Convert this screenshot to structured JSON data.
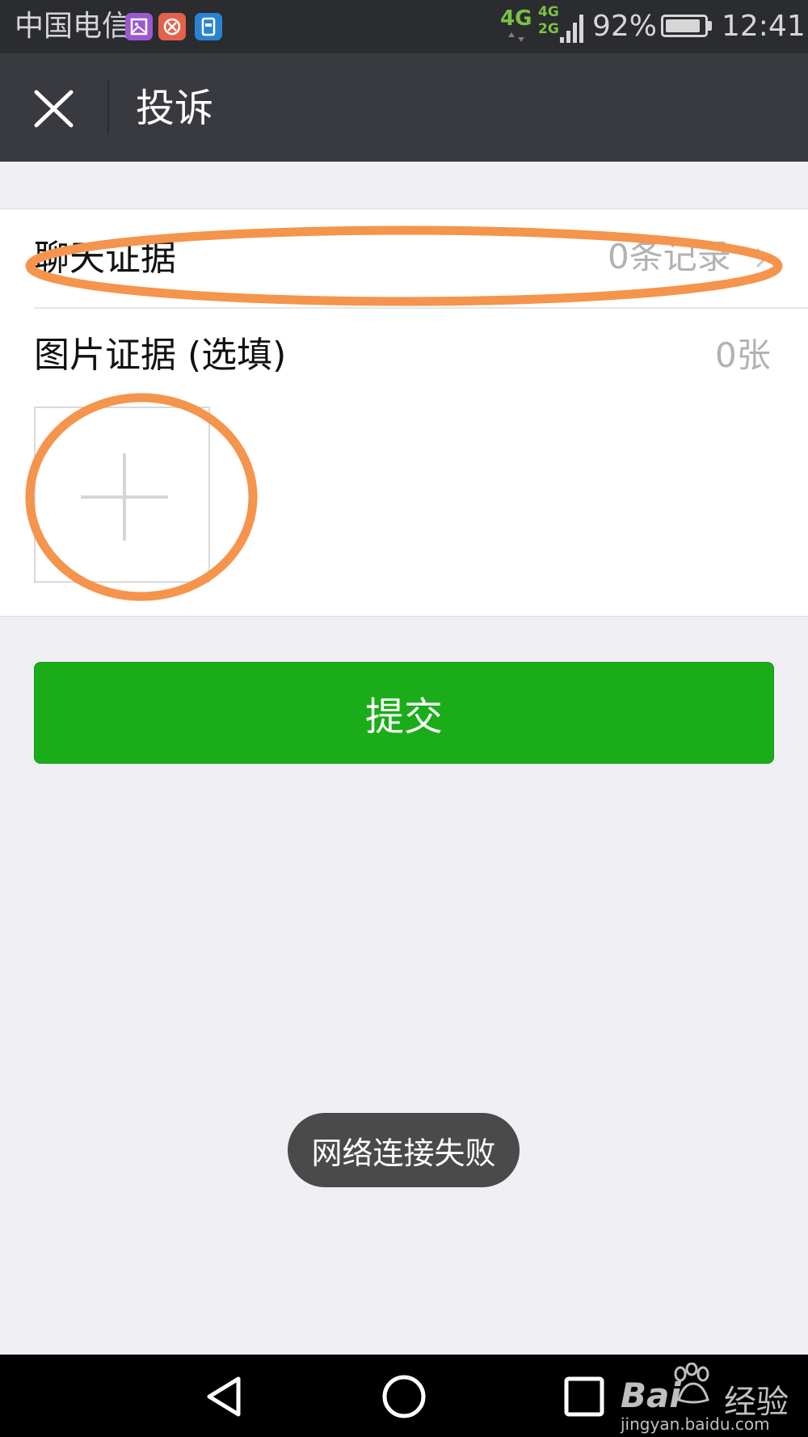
{
  "status_bar": {
    "carrier": "中国电信",
    "network_primary": "4G",
    "network_secondary": [
      "4G",
      "2G"
    ],
    "battery_percent": "92%",
    "battery_level": 0.92,
    "time": "12:41",
    "notification_icons": [
      "gallery-icon",
      "tools-icon",
      "sim-icon"
    ]
  },
  "header": {
    "title": "投诉",
    "close_icon": "close-icon"
  },
  "form": {
    "chat_evidence": {
      "label": "聊天证据",
      "value": "0条记录"
    },
    "photo_evidence": {
      "label": "图片证据 (选填)",
      "value": "0张"
    },
    "add_photo_icon": "plus-icon"
  },
  "submit": {
    "label": "提交"
  },
  "toast": {
    "message": "网络连接失败"
  },
  "nav": {
    "icons": [
      "back-icon",
      "home-icon",
      "recents-icon"
    ]
  },
  "watermark": {
    "brand": "Bai",
    "brand_suffix": "经验",
    "url": "jingyan.baidu.com"
  },
  "colors": {
    "title_bar": "#393a3f",
    "status_bar": "#2b2c30",
    "background": "#efeff4",
    "primary_green": "#1aad19",
    "annotation_orange": "#f5944c",
    "network_green": "#7bc143"
  }
}
